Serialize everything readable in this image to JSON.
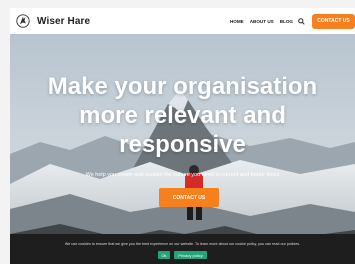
{
  "header": {
    "brand": "Wiser Hare",
    "logo_icon": "hare-logo-icon",
    "nav": [
      "HOME",
      "ABOUT US",
      "BLOG"
    ],
    "search_icon": "search-icon",
    "cta": "CONTACT US"
  },
  "hero": {
    "headline_lines": [
      "Make your organisation",
      "more relevant and",
      "responsive"
    ],
    "subline": "We help you create and sustain the culture you need in current and future times",
    "cta": "CONTACT US"
  },
  "cookie_bar": {
    "text": "We use cookies to ensure that we give you the best experience on our website. To learn more about our cookie policy, you can read our policies.",
    "ok_label": "Ok",
    "privacy_label": "Privacy policy"
  },
  "colors": {
    "accent": "#f7801e",
    "cookie_bg": "#1e1e1e",
    "cookie_button": "#22a578"
  }
}
